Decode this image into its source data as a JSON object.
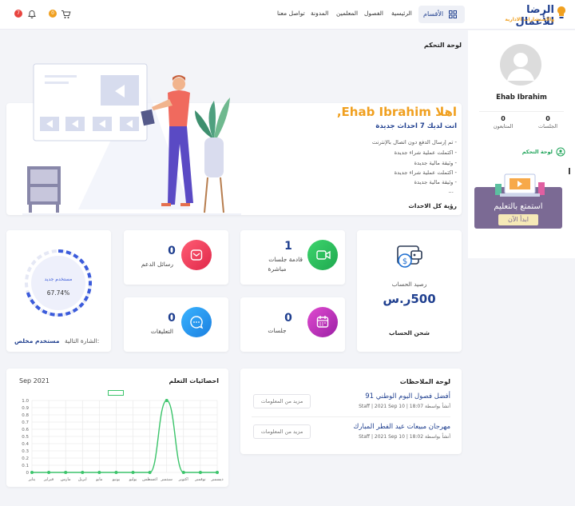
{
  "header": {
    "logo_main": "الرضا للأعمال",
    "logo_sub": "والاستشارات الادارية",
    "categories_label": "الأقسام",
    "nav": [
      "الرئيسية",
      "الفصول",
      "المعلمين",
      "المدونة",
      "تواصل معنا"
    ],
    "cart_badge": "0",
    "notif_badge": "7"
  },
  "profile": {
    "name": "Ehab Ibrahim",
    "sessions_count": "0",
    "sessions_label": "الجلسات",
    "followers_count": "0",
    "followers_label": "المتابعون",
    "menu_dashboard": "لوحة التحكم",
    "promo_line1": "استمتع بالتعليم",
    "promo_button": "ابدأ الآن"
  },
  "dashboard": {
    "title": "لوحة التحكم",
    "greeting": "اهلا Ehab Ibrahim,",
    "subtitle": "انت لديك 7 احداث جديدة",
    "events": [
      "- تم إرسال الدفع دون اتصال بالإنترنت",
      "- اكتملت عملية شراء جديدة",
      "- وثيقة مالية جديدة",
      "- اكتملت عملية شراء جديدة",
      "- وثيقة مالية جديدة"
    ],
    "ellipsis": "...",
    "view_all": "رؤية كل الاحداث"
  },
  "balance": {
    "label": "رصيد الحساب",
    "amount": "500ر.س",
    "charge_link": "شحن الحساب"
  },
  "stats": [
    {
      "value": "1",
      "label_1": "قادمة جلسات",
      "label_2": "مباشرة",
      "color": "#2bbf5f",
      "icon": "video-icon"
    },
    {
      "value": "0",
      "label_1": "رسائل الدعم",
      "color": "#f0435e",
      "icon": "mail-icon"
    },
    {
      "value": "0",
      "label_1": "جلسات",
      "color": "#c22fb5",
      "icon": "calendar-icon"
    },
    {
      "value": "0",
      "label_1": "التعليقات",
      "color": "#1e9cf0",
      "icon": "chat-icon"
    }
  ],
  "badge_progress": {
    "center_label": "مستخدم جديد",
    "percent": "67.74%",
    "percent_value": 67.74,
    "next_label": "الشارة التالية:",
    "next_value": "مستخدم مخلص"
  },
  "notes": {
    "title": "لوحة الملاحظات",
    "items": [
      {
        "title": "أفضل فصول اليوم الوطني 91",
        "meta": "أنشأ بواسطة Staff | 2021 Sep 10 | 18:07",
        "button": "مزيد من المعلومات"
      },
      {
        "title": "مهرجان مبيعات عيد الفطر المبارك",
        "meta": "أنشأ بواسطة Staff | 2021 Sep 10 | 18:02",
        "button": "مزيد من المعلومات"
      }
    ]
  },
  "chart_data": {
    "type": "line",
    "title": "احصائيات التعلم",
    "period": "Sep 2021",
    "categories": [
      "يناير",
      "فبراير",
      "مارس",
      "ابريل",
      "مايو",
      "يونيو",
      "يوليو",
      "اغسطس",
      "سبتمبر",
      "اكتوبر",
      "نوفمبر",
      "ديسمبر"
    ],
    "series": [
      {
        "values": [
          0,
          0,
          0,
          0,
          0,
          0,
          0,
          0,
          1,
          0,
          0,
          0
        ]
      }
    ],
    "ylim": [
      0,
      1
    ],
    "yticks": [
      "0",
      "0.1",
      "0.2",
      "0.3",
      "0.4",
      "0.5",
      "0.6",
      "0.7",
      "0.8",
      "0.9",
      "1.0"
    ],
    "grid": true,
    "line_color": "#3cc46b"
  }
}
